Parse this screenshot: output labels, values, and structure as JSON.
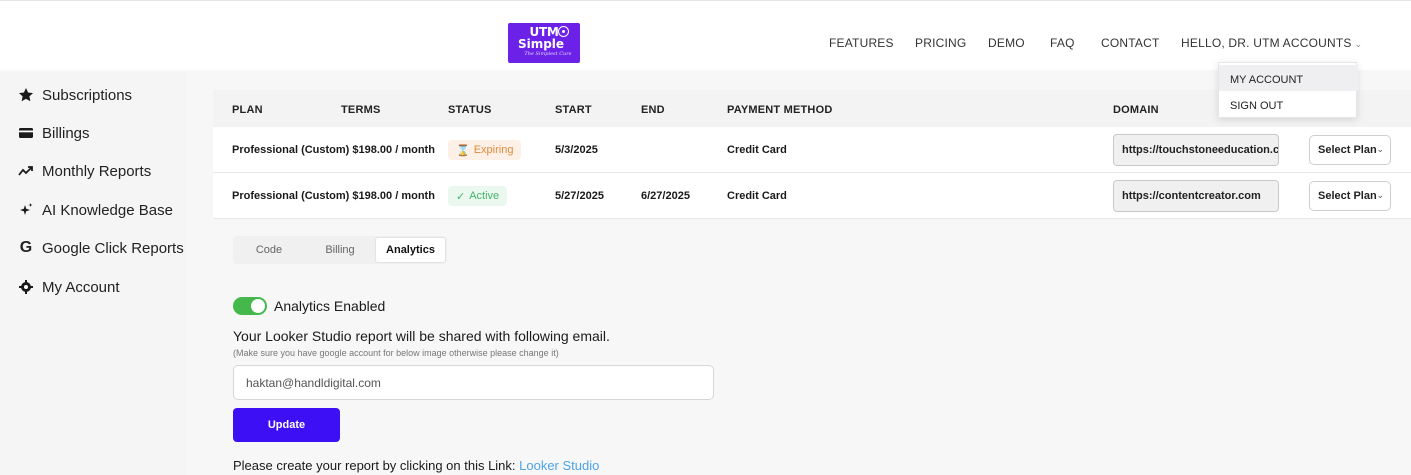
{
  "logo": {
    "line1": "UTM",
    "line2": "Simple",
    "tagline": "The Simplest Cure"
  },
  "nav": {
    "features": "FEATURES",
    "pricing": "PRICING",
    "demo": "DEMO",
    "faq": "FAQ",
    "contact": "CONTACT",
    "user": "HELLO, DR. UTM ACCOUNTS"
  },
  "user_menu": {
    "my_account": "MY ACCOUNT",
    "sign_out": "SIGN OUT"
  },
  "sidebar": {
    "items": [
      {
        "label": "Subscriptions",
        "icon": "star-icon"
      },
      {
        "label": "Billings",
        "icon": "credit-card-icon"
      },
      {
        "label": "Monthly Reports",
        "icon": "trend-up-icon"
      },
      {
        "label": "AI Knowledge Base",
        "icon": "sparkle-icon"
      },
      {
        "label": "Google Click Reports",
        "icon": "google-icon"
      },
      {
        "label": "My Account",
        "icon": "gear-icon"
      }
    ]
  },
  "table": {
    "headers": {
      "plan": "PLAN",
      "terms": "TERMS",
      "status": "STATUS",
      "start": "START",
      "end": "END",
      "payment": "PAYMENT METHOD",
      "domain": "DOMAIN"
    },
    "rows": [
      {
        "plan": "Professional (Custom) $198.00  / month",
        "status": "Expiring",
        "start": "5/3/2025",
        "end": "",
        "payment": "Credit Card",
        "domain": "https://touchstoneeducation.c...",
        "select": "Select Plan"
      },
      {
        "plan": "Professional (Custom) $198.00  / month",
        "status": "Active",
        "start": "5/27/2025",
        "end": "6/27/2025",
        "payment": "Credit Card",
        "domain": "https://contentcreator.com",
        "select": "Select Plan"
      }
    ]
  },
  "tabs": {
    "code": "Code",
    "billing": "Billing",
    "analytics": "Analytics"
  },
  "analytics": {
    "toggle_label": "Analytics Enabled",
    "heading": "Your Looker Studio report will be shared with following email.",
    "note": "(Make sure you have google account for below image otherwise please change it)",
    "email_value": "haktan@handldigital.com",
    "update_label": "Update",
    "link_prefix": "Please create your report by clicking on this Link: ",
    "link_text": "Looker Studio"
  },
  "colors": {
    "brand": "#6b21e8",
    "primary_button": "#3d0ff5",
    "toggle_on": "#45b84c",
    "link": "#4da3e8",
    "expiring": "#e08a3c",
    "active": "#46b26a"
  }
}
